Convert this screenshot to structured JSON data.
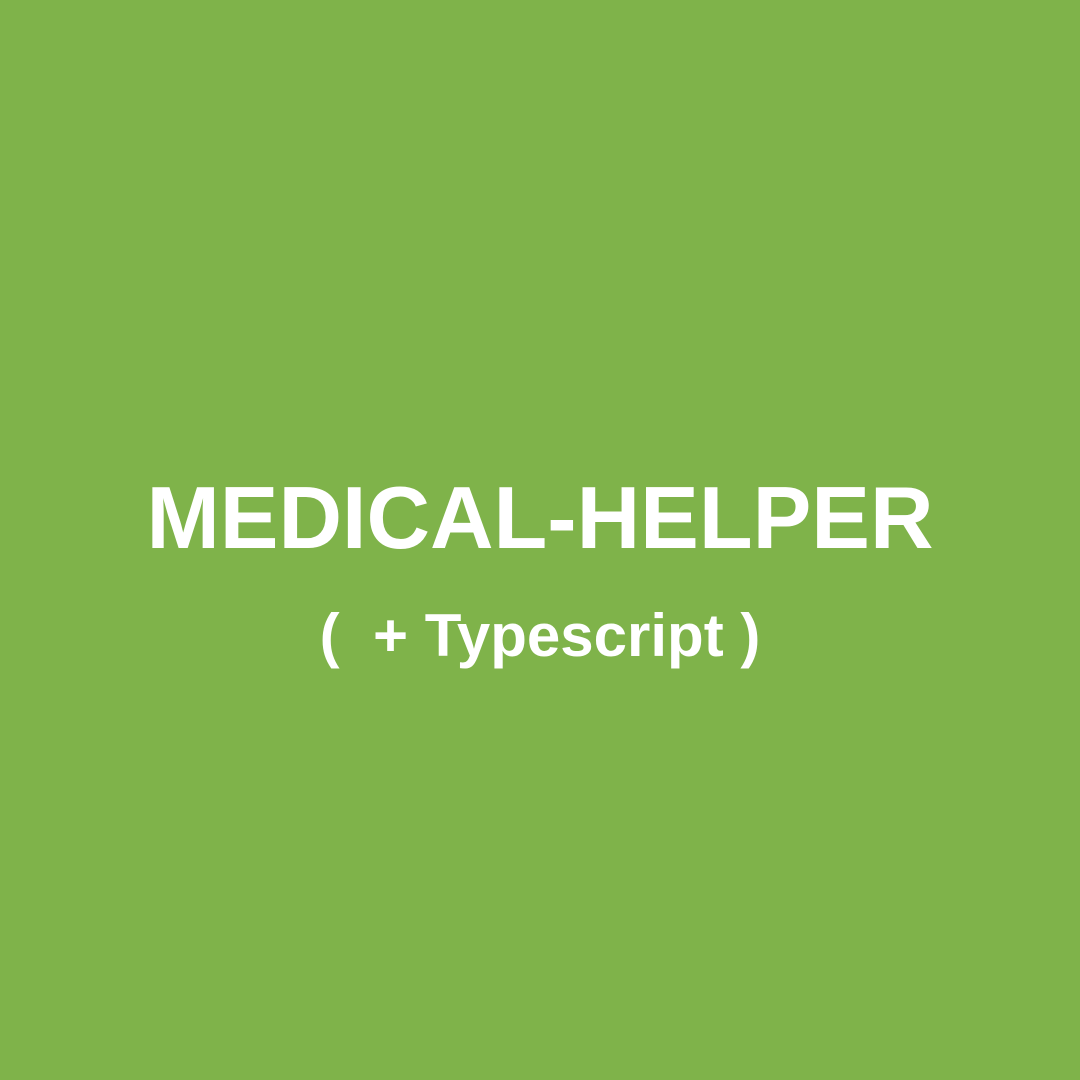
{
  "background_color": "#7fb34a",
  "text_color": "#ffffff",
  "title": "MEDICAL-HELPER",
  "subtitle": "(  + Typescript )"
}
